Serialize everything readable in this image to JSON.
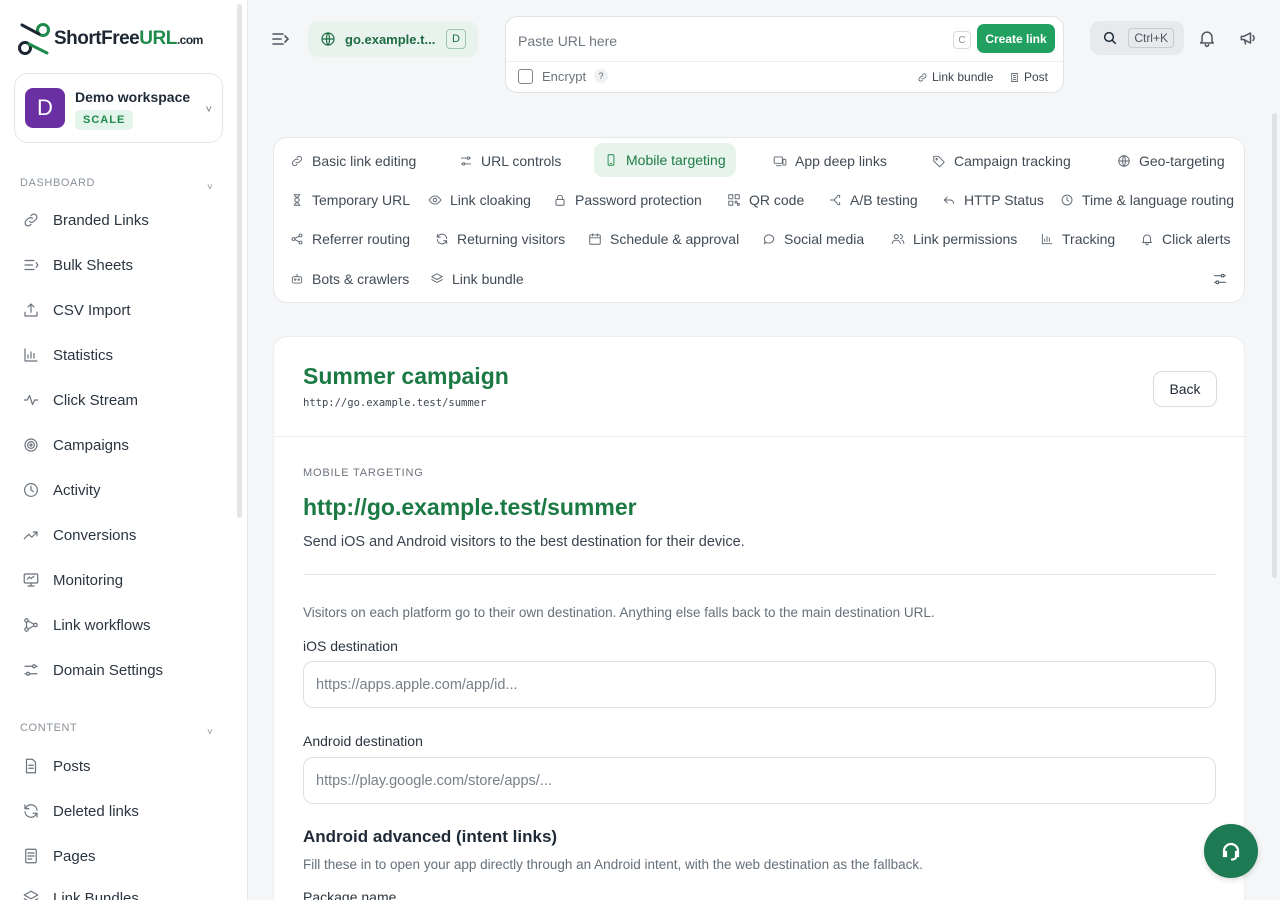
{
  "brand": {
    "prefix": "ShortFree",
    "highlight": "URL",
    "suffix": ".com"
  },
  "workspace": {
    "initial": "D",
    "name": "Demo workspace",
    "plan": "SCALE"
  },
  "sidebar": {
    "dashboard_heading": "DASHBOARD",
    "dashboard_items": [
      {
        "label": "Branded Links",
        "icon": "link-icon"
      },
      {
        "label": "Bulk Sheets",
        "icon": "list-icon"
      },
      {
        "label": "CSV Import",
        "icon": "upload-icon"
      },
      {
        "label": "Statistics",
        "icon": "bar-chart-icon"
      },
      {
        "label": "Click Stream",
        "icon": "pulse-icon"
      },
      {
        "label": "Campaigns",
        "icon": "target-icon"
      },
      {
        "label": "Activity",
        "icon": "clock-icon"
      },
      {
        "label": "Conversions",
        "icon": "trend-up-icon"
      },
      {
        "label": "Monitoring",
        "icon": "monitor-icon"
      },
      {
        "label": "Link workflows",
        "icon": "workflow-icon"
      },
      {
        "label": "Domain Settings",
        "icon": "sliders-icon"
      }
    ],
    "content_heading": "CONTENT",
    "content_items": [
      {
        "label": "Posts",
        "icon": "file-icon"
      },
      {
        "label": "Deleted links",
        "icon": "refresh-icon"
      },
      {
        "label": "Pages",
        "icon": "page-icon"
      },
      {
        "label": "Link Bundles",
        "icon": "layers-icon"
      }
    ]
  },
  "topbar": {
    "domain": "go.example.t...",
    "domain_shortcut": "D",
    "url_placeholder": "Paste URL here",
    "url_shortcut": "C",
    "create_label": "Create link",
    "encrypt_label": "Encrypt",
    "help_mark": "?",
    "link_bundle_label": "Link bundle",
    "post_label": "Post",
    "search_shortcut": "Ctrl+K"
  },
  "tabs": [
    {
      "label": "Basic link editing",
      "icon": "link-icon"
    },
    {
      "label": "URL controls",
      "icon": "sliders-icon"
    },
    {
      "label": "Mobile targeting",
      "icon": "phone-icon",
      "active": true
    },
    {
      "label": "App deep links",
      "icon": "devices-icon"
    },
    {
      "label": "Campaign tracking",
      "icon": "tag-icon"
    },
    {
      "label": "Geo-targeting",
      "icon": "globe-icon"
    },
    {
      "label": "Temporary URL",
      "icon": "hourglass-icon"
    },
    {
      "label": "Link cloaking",
      "icon": "eye-icon"
    },
    {
      "label": "Password protection",
      "icon": "lock-icon"
    },
    {
      "label": "QR code",
      "icon": "qr-icon"
    },
    {
      "label": "A/B testing",
      "icon": "split-icon"
    },
    {
      "label": "HTTP Status",
      "icon": "undo-icon"
    },
    {
      "label": "Time & language routing",
      "icon": "clock-icon"
    },
    {
      "label": "Referrer routing",
      "icon": "share-icon"
    },
    {
      "label": "Returning visitors",
      "icon": "refresh-icon"
    },
    {
      "label": "Schedule & approval",
      "icon": "calendar-icon"
    },
    {
      "label": "Social media",
      "icon": "chat-icon"
    },
    {
      "label": "Link permissions",
      "icon": "users-icon"
    },
    {
      "label": "Tracking",
      "icon": "bar-chart-icon"
    },
    {
      "label": "Click alerts",
      "icon": "bell-icon"
    },
    {
      "label": "Bots & crawlers",
      "icon": "robot-icon"
    },
    {
      "label": "Link bundle",
      "icon": "layers-icon"
    }
  ],
  "main": {
    "title": "Summer campaign",
    "short_url": "http://go.example.test/summer",
    "back_label": "Back",
    "section_label": "MOBILE TARGETING",
    "heading_url": "http://go.example.test/summer",
    "description": "Send iOS and Android visitors to the best destination for their device.",
    "note": "Visitors on each platform go to their own destination. Anything else falls back to the main destination URL.",
    "ios_label": "iOS destination",
    "ios_placeholder": "https://apps.apple.com/app/id...",
    "android_label": "Android destination",
    "android_placeholder": "https://play.google.com/store/apps/...",
    "advanced_title": "Android advanced (intent links)",
    "advanced_desc": "Fill these in to open your app directly through an Android intent, with the web destination as the fallback.",
    "package_label": "Package name"
  },
  "colors": {
    "brand_green": "#1f8a4c",
    "button_green": "#22a060",
    "avatar_purple": "#6a2fa3",
    "fab_green": "#1e7a52"
  }
}
